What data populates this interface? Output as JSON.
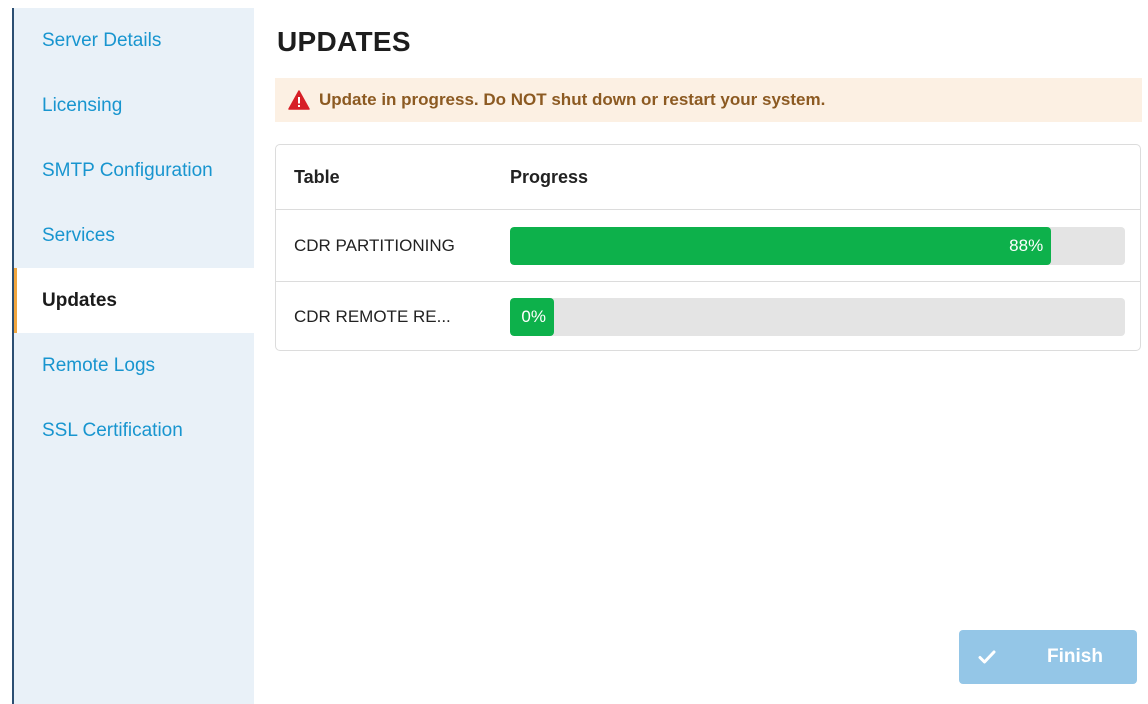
{
  "sidebar": {
    "items": [
      {
        "label": "Server Details"
      },
      {
        "label": "Licensing"
      },
      {
        "label": "SMTP Configuration"
      },
      {
        "label": "Services"
      },
      {
        "label": "Updates"
      },
      {
        "label": "Remote Logs"
      },
      {
        "label": "SSL Certification"
      }
    ],
    "active_item": "Updates"
  },
  "main": {
    "title": "UPDATES",
    "alert": {
      "icon": "warning-triangle-icon",
      "text": "Update in progress. Do NOT shut down or restart your system."
    },
    "table": {
      "headers": [
        "Table",
        "Progress"
      ],
      "rows": [
        {
          "name": "CDR PARTITIONING",
          "progress": 88,
          "progress_label": "88%"
        },
        {
          "name": "CDR REMOTE RE...",
          "progress": 0,
          "progress_label": "0%"
        }
      ]
    },
    "finish_button": {
      "label": "Finish",
      "icon": "check-icon"
    }
  },
  "colors": {
    "accent": "#1895cf",
    "sidebar_bg": "#e9f1f8",
    "active_indicator": "#f0a640",
    "alert_bg": "#fcf0e3",
    "alert_text": "#8c5a22",
    "warning_icon": "#d71f26",
    "progress_fill": "#0db14b",
    "progress_track": "#e4e4e4",
    "finish_button": "#94c6e7"
  }
}
